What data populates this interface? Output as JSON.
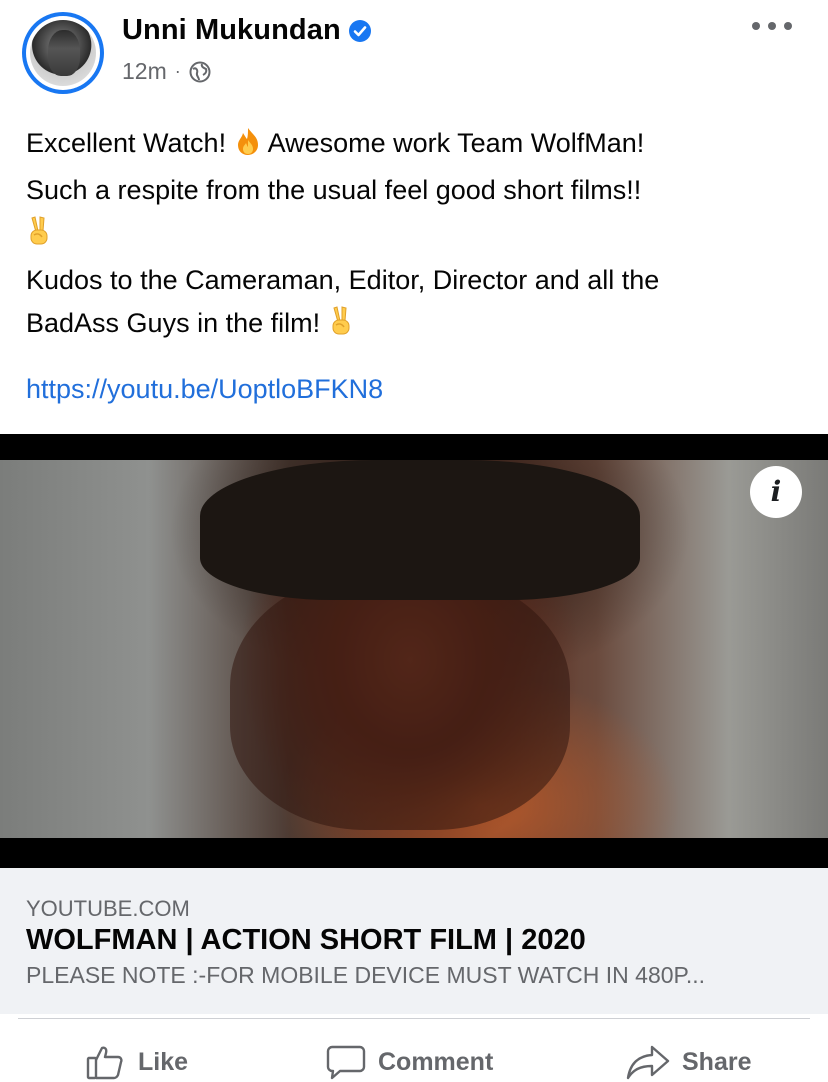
{
  "post": {
    "author": "Unni Mukundan",
    "verified_icon": "verified-badge-icon",
    "time": "12m",
    "separator": "·",
    "privacy_icon": "globe-icon",
    "menu_icon": "more-options-icon",
    "text": {
      "line1a": "Excellent Watch! ",
      "line1b": " Awesome work Team WolfMan!",
      "line2": "Such a respite from the usual feel good short films!!",
      "line3": "Kudos to the Cameraman, Editor, Director and all the",
      "line4": "BadAss Guys in the film! "
    },
    "link": "https://youtu.be/UoptloBFKN8"
  },
  "link_preview": {
    "domain": "YOUTUBE.COM",
    "title": "WOLFMAN | ACTION SHORT FILM | 2020",
    "description": "PLEASE NOTE :-FOR MOBILE DEVICE MUST WATCH IN 480P...",
    "info_label": "i"
  },
  "actions": {
    "like": "Like",
    "comment": "Comment",
    "share": "Share"
  },
  "colors": {
    "accent": "#1877f2",
    "link": "#216fdb",
    "secondary_text": "#65676b"
  }
}
